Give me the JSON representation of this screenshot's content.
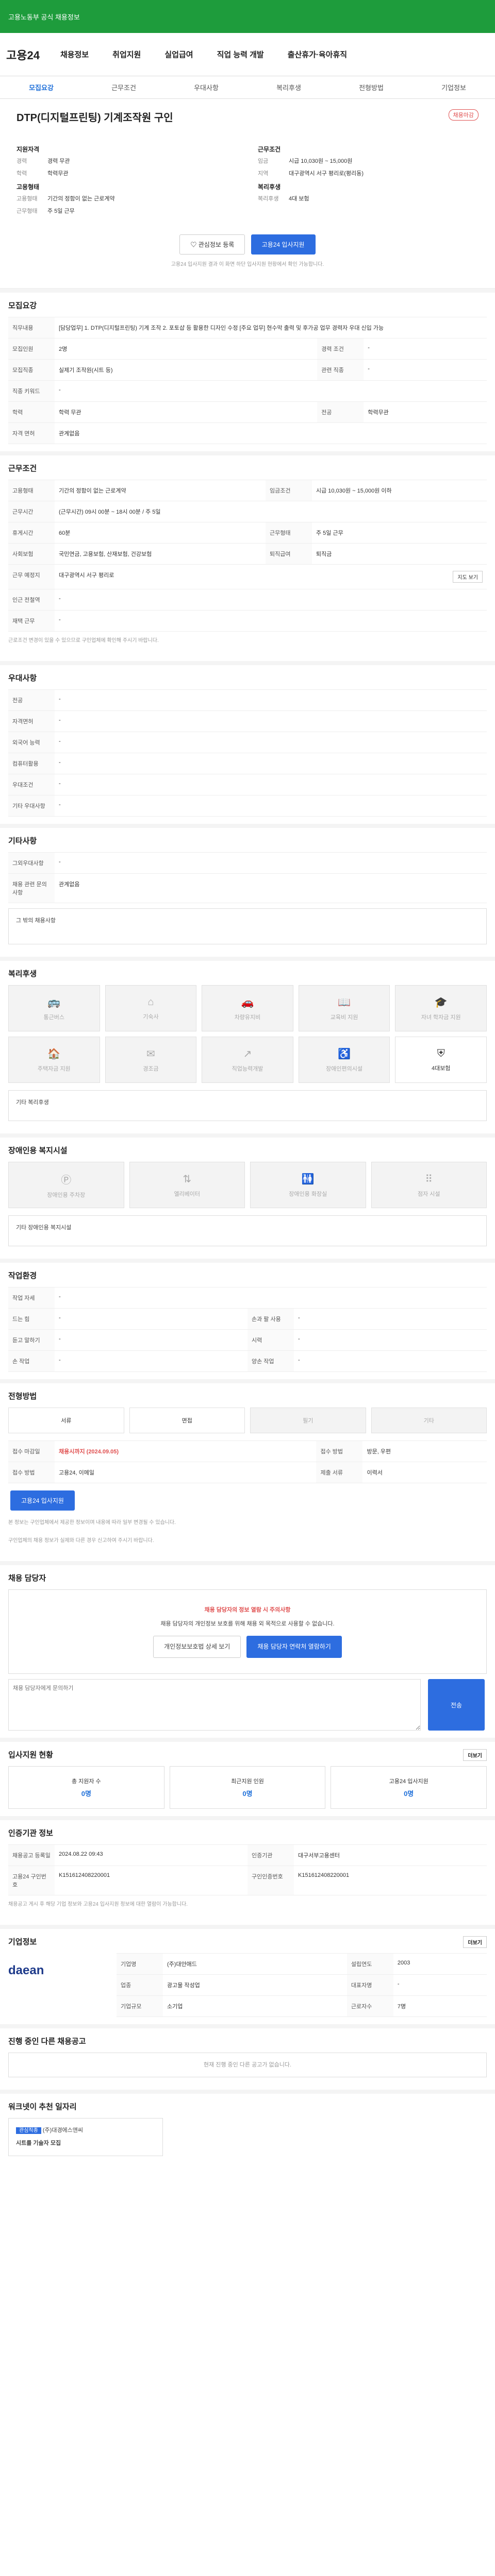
{
  "topbar": {
    "text": "고용노동부 공식 채용정보"
  },
  "header": {
    "logo": "고용24",
    "nav": [
      "채용정보",
      "취업지원",
      "실업급여",
      "직업 능력 개발",
      "출산휴가·육아휴직"
    ]
  },
  "tabs": [
    "모집요강",
    "근무조건",
    "우대사항",
    "복리후생",
    "전형방법",
    "기업정보"
  ],
  "job": {
    "title": "DTP(디지털프린팅) 기계조작원 구인",
    "badge": "채용마감",
    "left_heading": "지원자격",
    "left_rows": [
      [
        "경력",
        "경력 무관"
      ],
      [
        "학력",
        "학력무관"
      ]
    ],
    "left_heading2": "고용형태",
    "left_rows2": [
      [
        "고용형태",
        "기간의 정함이 없는 근로계약"
      ],
      [
        "근무형태",
        "주 5일 근무"
      ]
    ],
    "right_heading": "근무조건",
    "right_rows": [
      [
        "임금",
        "시급 10,030원 ~ 15,000원"
      ],
      [
        "지역",
        "대구광역시 서구 평리로(평리동)"
      ]
    ],
    "right_heading2": "복리후생",
    "right_rows2": [
      [
        "복리후생",
        "4대 보험"
      ]
    ],
    "btn_save": "관심정보 등록",
    "btn_apply": "고용24 입사지원",
    "note": "고용24 입사지원 결과 이 화면 하단 입사지원 현황에서 확인 가능합니다."
  },
  "recruit": {
    "heading": "모집요강",
    "desc_label": "직무내용",
    "desc": "[담당업무] 1. DTP(디지털프린팅) 기계 조작 2. 포토샵 등 활용한 디자인 수정 [주요 업무] 현수막 출력 및 후가공 업무 경력자 우대 신입 가능",
    "rows": [
      [
        "모집인원",
        "2명",
        "경력 조건",
        "-"
      ],
      [
        "모집직종",
        "실제기 조작원(시트 등)",
        "관련 직종",
        "-"
      ],
      [
        "직종 키워드",
        "-",
        "",
        ""
      ],
      [
        "학력",
        "학력 무관",
        "전공",
        "학력무관"
      ],
      [
        "자격 면허",
        "관계없음",
        "",
        ""
      ]
    ]
  },
  "condition": {
    "heading": "근무조건",
    "rows": [
      [
        "고용형태",
        "기간의 정함이 없는 근로계약",
        "임금조건",
        "시급 10,030원 ~ 15,000원 이하"
      ],
      [
        "근무시간",
        "(근무시간) 09시 00분 ~ 18시 00분 / 주 5일",
        "",
        ""
      ],
      [
        "휴게시간",
        "60분",
        "근무형태",
        "주 5일 근무"
      ],
      [
        "사회보험",
        "국민연금, 고용보험, 산재보험, 건강보험",
        "퇴직급여",
        "퇴직금"
      ],
      [
        "근무 예정지",
        "대구광역시 서구 평리로",
        "",
        ""
      ],
      [
        "인근 전철역",
        "-",
        "",
        ""
      ],
      [
        "재택 근무",
        "-",
        "",
        ""
      ]
    ],
    "map_btn": "지도 보기",
    "note": "근로조건 변경이 있을 수 있으므로 구인업체에 확인해 주시기 바랍니다."
  },
  "prefer": {
    "heading": "우대사항",
    "rows": [
      [
        "전공",
        "-"
      ],
      [
        "자격면허",
        "-"
      ],
      [
        "외국어 능력",
        "-"
      ],
      [
        "컴퓨터활용",
        "-"
      ],
      [
        "우대조건",
        "-"
      ],
      [
        "기타 우대사항",
        "-"
      ]
    ]
  },
  "etc": {
    "heading": "기타사항",
    "rows": [
      [
        "그외우대사항",
        "-"
      ],
      [
        "채용 관련 문의 사항",
        "관계없음"
      ]
    ],
    "box": "그 밖의 채용사항"
  },
  "welfare": {
    "heading": "복리후생",
    "items": [
      "통근버스",
      "기숙사",
      "차량유지비",
      "교육비 지원",
      "자녀 학자금 지원",
      "주택자금 지원",
      "경조금",
      "직업능력개발",
      "장애인편의시설",
      "4대보험"
    ],
    "active": [
      9
    ],
    "box_label": "기타 복리후생"
  },
  "disability": {
    "heading": "장애인용 복지시설",
    "items": [
      "장애인용 주차장",
      "엘리베이터",
      "장애인용 화장실",
      "점자 시설"
    ],
    "box_label": "기타 장애인용 복지시설"
  },
  "env": {
    "heading": "작업환경",
    "rows": [
      [
        "작업 자세",
        "-",
        "",
        ""
      ],
      [
        "드는 힘",
        "-",
        "손과 팔 사용",
        "-"
      ],
      [
        "듣고 말하기",
        "-",
        "시력",
        "-"
      ],
      [
        "손 작업",
        "-",
        "양손 작업",
        "-"
      ]
    ]
  },
  "selection": {
    "heading": "전형방법",
    "steps": [
      "서류",
      "면접",
      "필기",
      "기타"
    ],
    "rows": [
      [
        "접수 마감일",
        "채용시까지 (2024.09.05)",
        "접수 방법",
        "방문, 우편"
      ],
      [
        "접수 방법",
        "고용24, 이메일",
        "제출 서류",
        "이력서"
      ]
    ],
    "apply_btn": "고용24 입사지원",
    "notes": [
      "본 정보는 구인업체에서 제공한 정보이며 내용에 따라 일부 변경될 수 있습니다.",
      "구인업체의 채용 정보가 실제와 다른 경우 신고하여 주시기 바랍니다."
    ]
  },
  "inquiry": {
    "heading": "채용 담당자",
    "warn": "채용 담당자의 정보 열람 시 주의사항",
    "msg": "채용 담당자의 개인정보 보호를 위해 채용 외 목적으로 사용할 수 없습니다.",
    "btn_a": "개인정보보호법 상세 보기",
    "btn_b": "채용 담당자 연락처 열람하기",
    "input_label": "채용 담당자에게 문의하기",
    "submit": "전송"
  },
  "status": {
    "heading": "입사지원 현황",
    "more": "더보기",
    "cards": [
      [
        "총 지원자 수",
        "0명"
      ],
      [
        "최근지원 인원",
        "0명"
      ],
      [
        "고용24 입사지원",
        "0명"
      ]
    ]
  },
  "posting": {
    "heading": "인증기관 정보",
    "rows": [
      [
        "채용공고 등록일",
        "2024.08.22 09:43",
        "인증기관",
        "대구서부고용센터"
      ],
      [
        "고용24 구인번호",
        "K151612408220001",
        "구인인증번호",
        "K151612408220001"
      ]
    ],
    "note": "채용공고 게시 후 해당 기업 정보와 고용24 입사지원 정보에 대한 열람이 가능합니다."
  },
  "company": {
    "heading": "기업정보",
    "logo": "daean",
    "more": "더보기",
    "rows": [
      [
        "기업명",
        "(주)대안애드",
        "설립연도",
        "2003"
      ],
      [
        "업종",
        "광고물 작성업",
        "대표자명",
        "-"
      ],
      [
        "기업규모",
        "소기업",
        "근로자수",
        "7명"
      ]
    ]
  },
  "other": {
    "heading": "진행 중인 다른 채용공고",
    "empty": "현재 진행 중인 다른 공고가 없습니다."
  },
  "recommend": {
    "heading": "워크넷이 추천 일자리",
    "tag": "관심직종",
    "company": "(주)대경에스앤씨",
    "title": "시트를 기술자 모집"
  }
}
